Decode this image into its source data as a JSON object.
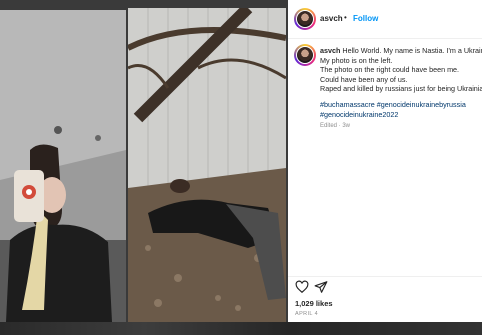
{
  "post": {
    "username": "asvch",
    "follow_label": "Follow",
    "separator": "•",
    "caption": {
      "username": "asvch",
      "lines": [
        "Hello World. My name is Nastia. I'm a Ukrainian",
        "My photo is on the left.",
        "The photo on the right could have been me.",
        "Could have been any of us.",
        "Raped and killed by russians just for being Ukrainian"
      ],
      "hashtags_line1": "#buchamassacre #genocideinukrainebyrussia",
      "hashtags_line2": "#genocideinukraine2022",
      "edited": "Edited · 3w"
    },
    "likes": "1,029 likes",
    "date": "APRIL 4"
  },
  "icons": {
    "like": "heart-icon",
    "share": "share-icon"
  },
  "colors": {
    "follow": "#0095f6",
    "hashtag": "#00376b",
    "text": "#262626",
    "muted": "#8e8e8e"
  }
}
